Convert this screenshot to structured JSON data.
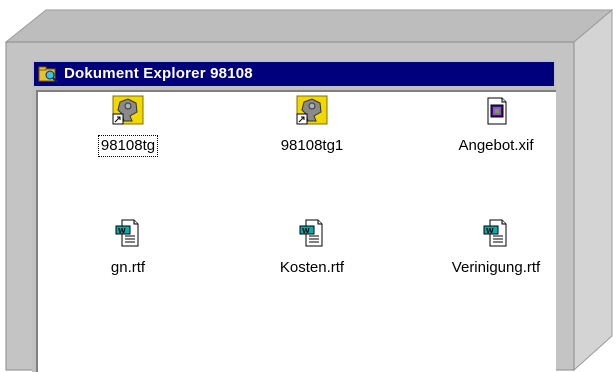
{
  "window": {
    "title": "Dokument Explorer 98108"
  },
  "files": [
    {
      "name": "98108tg",
      "icon": "shortcut-program-icon",
      "selected": true
    },
    {
      "name": "98108tg1",
      "icon": "shortcut-program-icon",
      "selected": false
    },
    {
      "name": "Angebot.xif",
      "icon": "xif-document-icon",
      "selected": false
    },
    {
      "name": "gn.rtf",
      "icon": "rtf-document-icon",
      "selected": false
    },
    {
      "name": "Kosten.rtf",
      "icon": "rtf-document-icon",
      "selected": false
    },
    {
      "name": "Verinigung.rtf",
      "icon": "rtf-document-icon",
      "selected": false
    }
  ],
  "colors": {
    "titlebar": "#00007c",
    "frame": "#c0c0c0",
    "box_top": "#bdbdbd",
    "box_side": "#d4d4d4"
  }
}
